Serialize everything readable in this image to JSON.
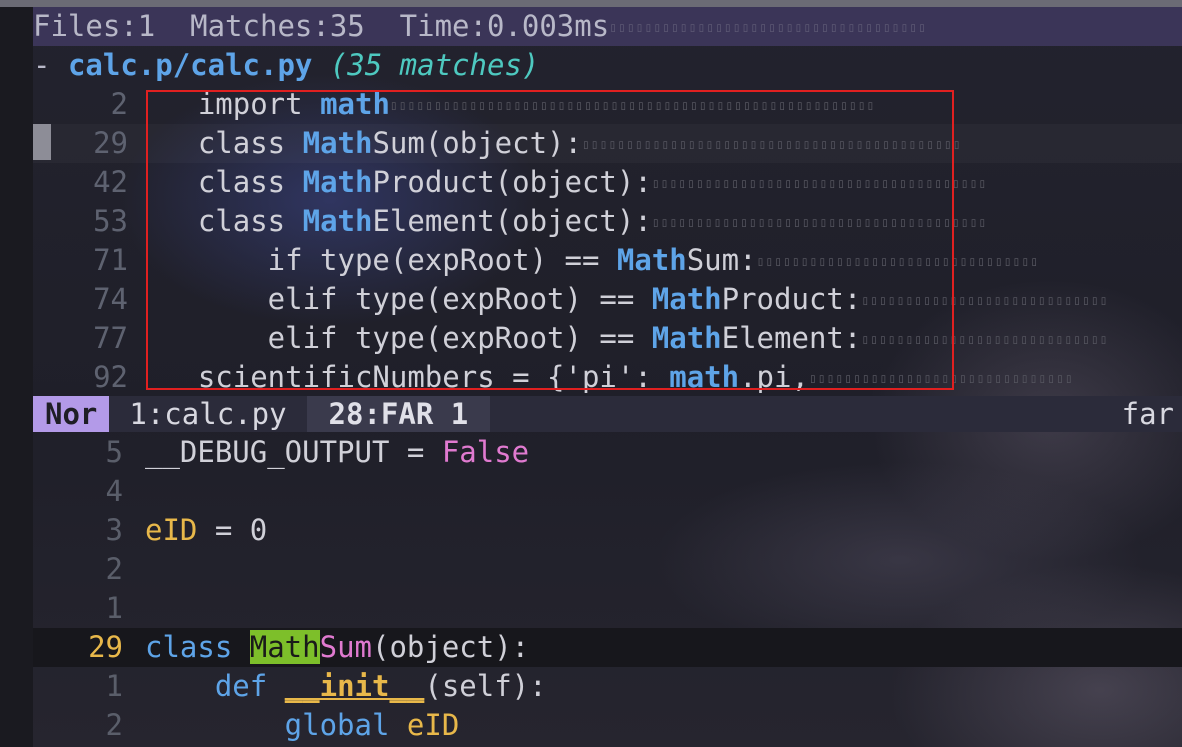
{
  "header": {
    "files_label": "Files:1",
    "matches_label": "Matches:35",
    "time_label": "Time:0.003ms"
  },
  "file_group": {
    "dash": "-",
    "name": "calc.p/calc.py",
    "count": "(35 matches)"
  },
  "results": [
    {
      "line": "2",
      "pre": "    import ",
      "kw": "math",
      "post": ""
    },
    {
      "line": "29",
      "pre": "    class ",
      "kw": "Math",
      "post": "Sum(object):"
    },
    {
      "line": "42",
      "pre": "    class ",
      "kw": "Math",
      "post": "Product(object):"
    },
    {
      "line": "53",
      "pre": "    class ",
      "kw": "Math",
      "post": "Element(object):"
    },
    {
      "line": "71",
      "pre": "        if type(expRoot) == ",
      "kw": "Math",
      "post": "Sum:"
    },
    {
      "line": "74",
      "pre": "        elif type(expRoot) == ",
      "kw": "Math",
      "post": "Product:"
    },
    {
      "line": "77",
      "pre": "        elif type(expRoot) == ",
      "kw": "Math",
      "post": "Element:"
    },
    {
      "line": "92",
      "pre": "    scientificNumbers = {'pi': ",
      "kw": "math",
      "post": ".pi,"
    }
  ],
  "statusbar": {
    "mode": "Nor",
    "buffer": "1:calc.py",
    "far": "28:FAR 1",
    "right": "far"
  },
  "editor": {
    "lines": [
      {
        "num": "5",
        "a": "__DEBUG_OUTPUT = ",
        "b": "False"
      },
      {
        "num": "4",
        "a": "",
        "b": ""
      },
      {
        "num": "3",
        "a": "eID",
        "b": " = 0"
      },
      {
        "num": "2",
        "a": "",
        "b": ""
      },
      {
        "num": "1",
        "a": "",
        "b": ""
      },
      {
        "num": "29",
        "kw": "class ",
        "match": "Math",
        "cls": "Sum",
        "rest": "(object):"
      },
      {
        "num": "1",
        "kw": "    def ",
        "fn": "__init__",
        "rest": "(self):"
      },
      {
        "num": "2",
        "kw": "        global ",
        "var": "eID"
      }
    ]
  },
  "colors": {
    "accent_mode": "#b39ae8",
    "match_highlight": "#7dbf2a",
    "keyword": "#5ea4e8",
    "selection_box": "#e02020"
  }
}
